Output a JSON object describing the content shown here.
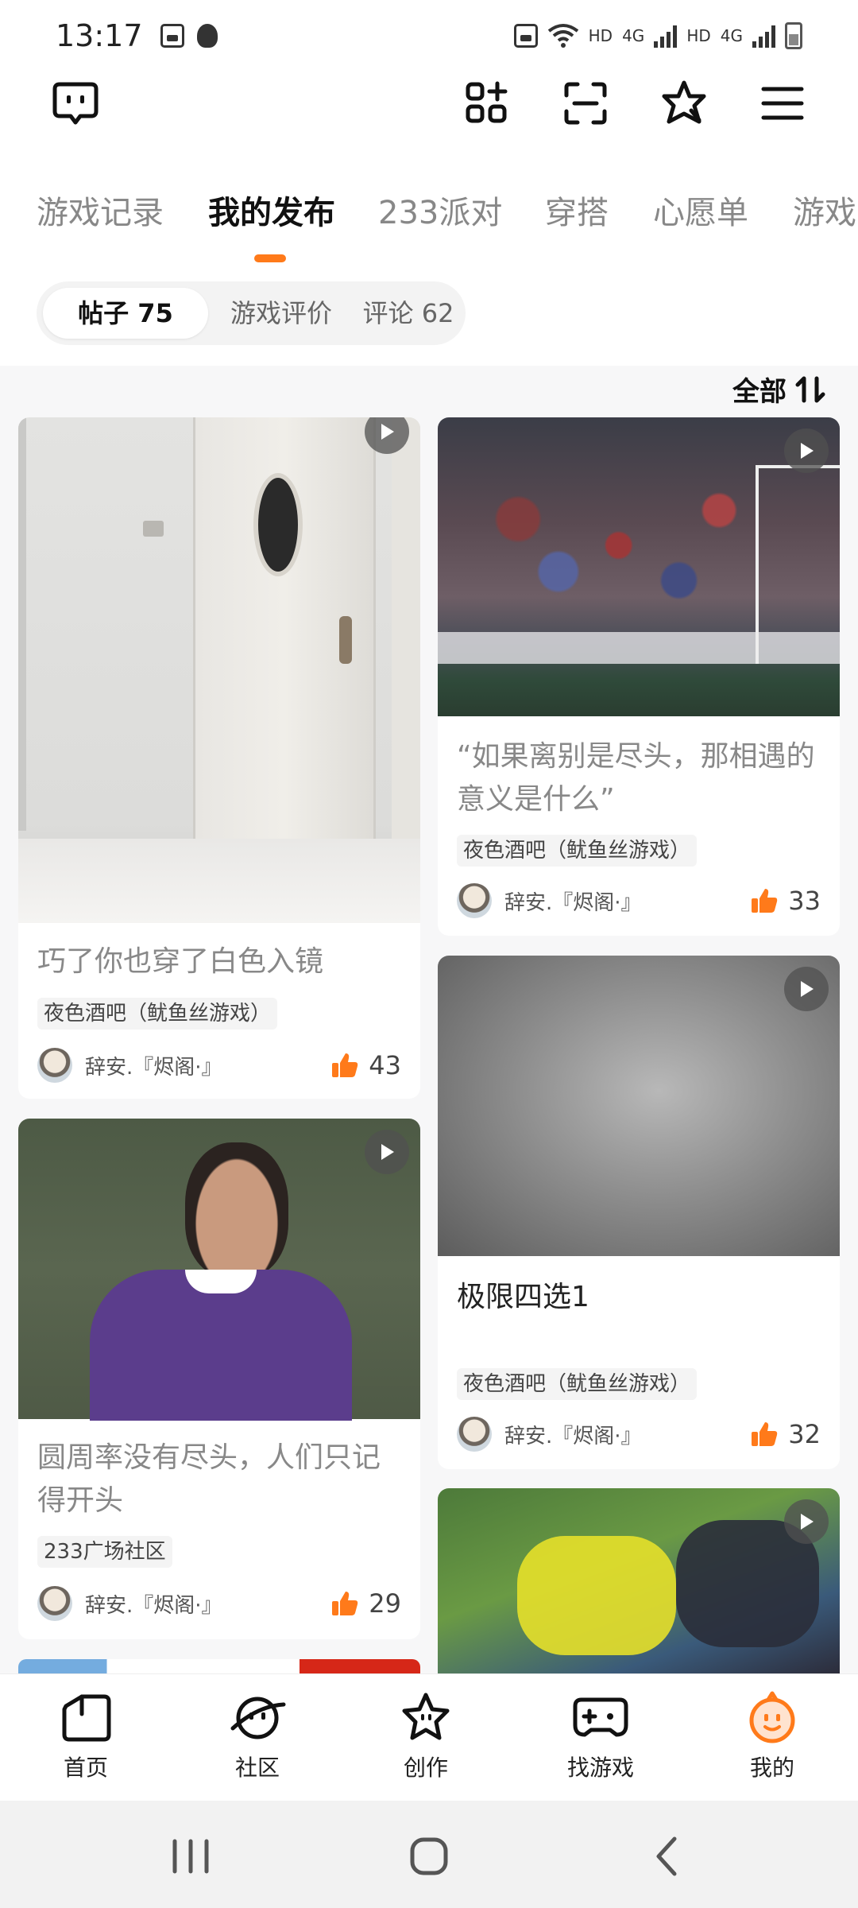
{
  "status_bar": {
    "time": "13:17",
    "hd1": "HD",
    "net1": "4G",
    "hd2": "HD",
    "net2": "4G"
  },
  "tabs": [
    "游戏记录",
    "我的发布",
    "233派对",
    "穿搭",
    "心愿单",
    "游戏"
  ],
  "active_tab": "我的发布",
  "segments": [
    "帖子 75",
    "游戏评价",
    "评论 62"
  ],
  "sort_label": "全部",
  "posts": [
    {
      "title": "巧了你也穿了白色入镜",
      "tag": "夜色酒吧（鱿鱼丝游戏）",
      "author": "辞安.『烬阁·』",
      "likes": "43"
    },
    {
      "title": "“如果离别是尽头，那相遇的意义是什么”",
      "tag": "夜色酒吧（鱿鱼丝游戏）",
      "author": "辞安.『烬阁·』",
      "likes": "33"
    },
    {
      "title": "极限四选1",
      "tag": "夜色酒吧（鱿鱼丝游戏）",
      "author": "辞安.『烬阁·』",
      "likes": "32"
    },
    {
      "title": "圆周率没有尽头，人们只记得开头",
      "tag": "233广场社区",
      "author": "辞安.『烬阁·』",
      "likes": "29"
    }
  ],
  "bottom_nav": [
    "首页",
    "社区",
    "创作",
    "找游戏",
    "我的"
  ],
  "colors": {
    "accent": "#ff7a1a",
    "feed_bg": "#f7f7f8"
  },
  "icons": [
    "chat-bubble-icon",
    "grid-plus-icon",
    "scan-icon",
    "star-badge-icon",
    "menu-icon",
    "sort-icon",
    "play-icon",
    "thumb-up-icon"
  ]
}
